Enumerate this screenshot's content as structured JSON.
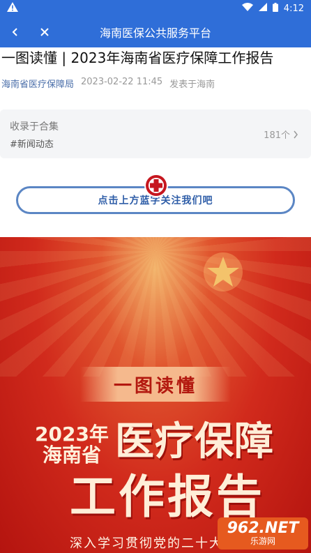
{
  "status_bar": {
    "time": "4:12"
  },
  "nav": {
    "title": "海南医保公共服务平台"
  },
  "article": {
    "title": "一图读懂 | 2023年海南省医疗保障工作报告",
    "author": "海南省医疗保障局",
    "datetime": "2023-02-22 11:45",
    "location": "发表于海南"
  },
  "collection": {
    "label": "收录于合集",
    "tag": "#新闻动态",
    "count": "181个"
  },
  "follow_prompt": "点击上方蓝字关注我们吧",
  "poster": {
    "banner": "一图读懂",
    "year": "2023年",
    "province": "海南省",
    "heading1": "医疗保障",
    "heading2": "工作报告",
    "subtitle": "深入学习贯彻党的二十大精神"
  },
  "watermark": {
    "brand": "962.NET",
    "site": "乐游网"
  },
  "colors": {
    "nav_bg": "#2f6ed8",
    "poster_red": "#d12a1c",
    "accent_blue": "#5b86c4"
  }
}
